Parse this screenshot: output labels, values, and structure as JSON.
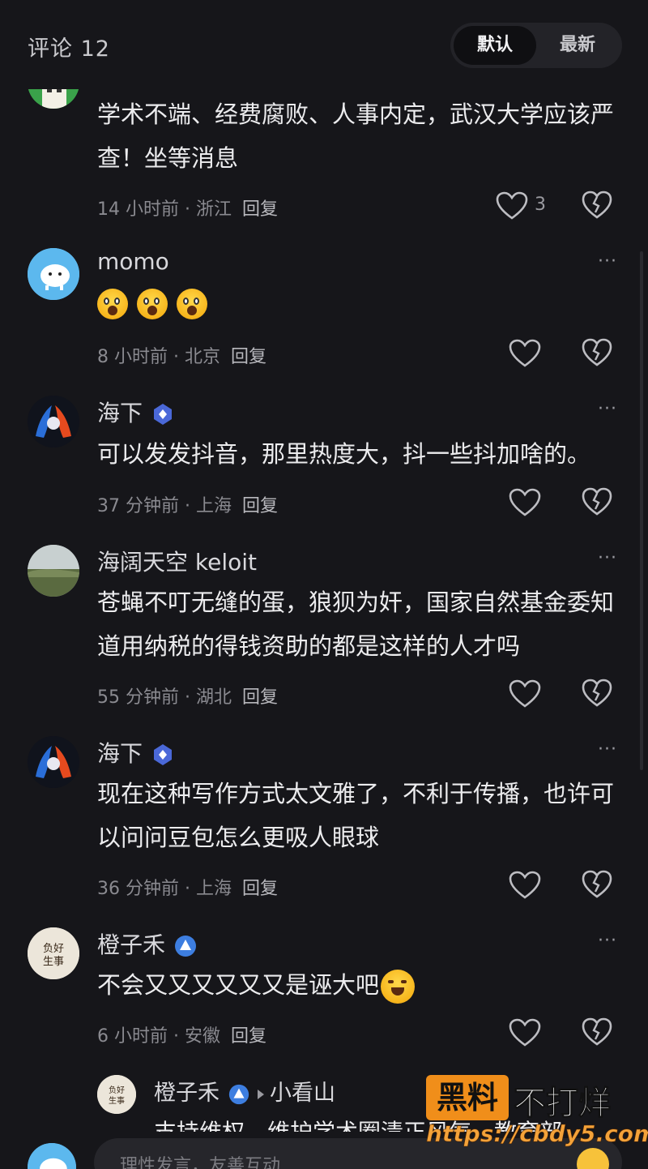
{
  "header": {
    "title": "评论 12",
    "sort_default": "默认",
    "sort_latest": "最新"
  },
  "comments": [
    {
      "text": "学术不端、经费腐败、人事内定，武汉大学应该严查！坐等消息",
      "time": "14 小时前",
      "location": "浙江",
      "reply": "回复",
      "likes": "3"
    },
    {
      "name": "momo",
      "time": "8 小时前",
      "location": "北京",
      "reply": "回复"
    },
    {
      "name": "海下",
      "text": "可以发发抖音，那里热度大，抖一些抖加啥的。",
      "time": "37 分钟前",
      "location": "上海",
      "reply": "回复"
    },
    {
      "name": "海阔天空 keloit",
      "text": "苍蝇不叮无缝的蛋，狼狈为奸，国家自然基金委知道用纳税的得钱资助的都是这样的人才吗",
      "time": "55 分钟前",
      "location": "湖北",
      "reply": "回复"
    },
    {
      "name": "海下",
      "text": "现在这种写作方式太文雅了，不利于传播，也许可以问问豆包怎么更吸人眼球",
      "time": "36 分钟前",
      "location": "上海",
      "reply": "回复"
    },
    {
      "name": "橙子禾",
      "text": "不会又又又又又又是诬大吧",
      "time": "6 小时前",
      "location": "安徽",
      "reply": "回复"
    }
  ],
  "sub_reply": {
    "name": "橙子禾",
    "reply_to": "小看山",
    "text": "支持维权，维护学术圈清正风气，教育部"
  },
  "input": {
    "placeholder": "理性发言，友善互动"
  },
  "watermark": {
    "block": "黑料",
    "text": "不打烊",
    "url": "https://cbdy5.com"
  },
  "separator": "·",
  "more": "···"
}
